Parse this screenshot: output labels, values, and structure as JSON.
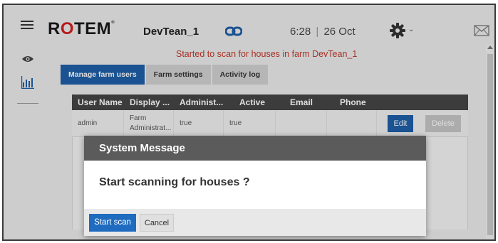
{
  "header": {
    "logo": {
      "part1": "R",
      "part2": "O",
      "part3": "TEM",
      "mark": "®"
    },
    "farm_name": "DevTean_1",
    "time": "6:28",
    "date_sep": "|",
    "date": "26 Oct",
    "icons": [
      "menu-icon",
      "link-icon",
      "gear-icon",
      "chevron-down-icon",
      "mail-icon"
    ]
  },
  "sidebar": {
    "icons": [
      "eye-icon",
      "bar-chart-icon"
    ]
  },
  "notice": "Started to scan for houses in farm DevTean_1",
  "tabs": [
    {
      "label": "Manage farm users",
      "active": true
    },
    {
      "label": "Farm settings",
      "active": false
    },
    {
      "label": "Activity log",
      "active": false
    }
  ],
  "table": {
    "columns": [
      "User Name",
      "Display ...",
      "Administ...",
      "Active",
      "Email",
      "Phone"
    ],
    "rows": [
      {
        "user_name": "admin",
        "display": "Farm Administrat...",
        "admin": "true",
        "active": "true",
        "email": "",
        "phone": ""
      }
    ],
    "edit_label": "Edit",
    "delete_label": "Delete"
  },
  "modal": {
    "title": "System Message",
    "message": "Start scanning for houses ?",
    "start_label": "Start scan",
    "cancel_label": "Cancel"
  },
  "colors": {
    "brand_red": "#d31f1f",
    "accent_blue": "#1e5fa8",
    "notice_red": "#c0392b"
  }
}
